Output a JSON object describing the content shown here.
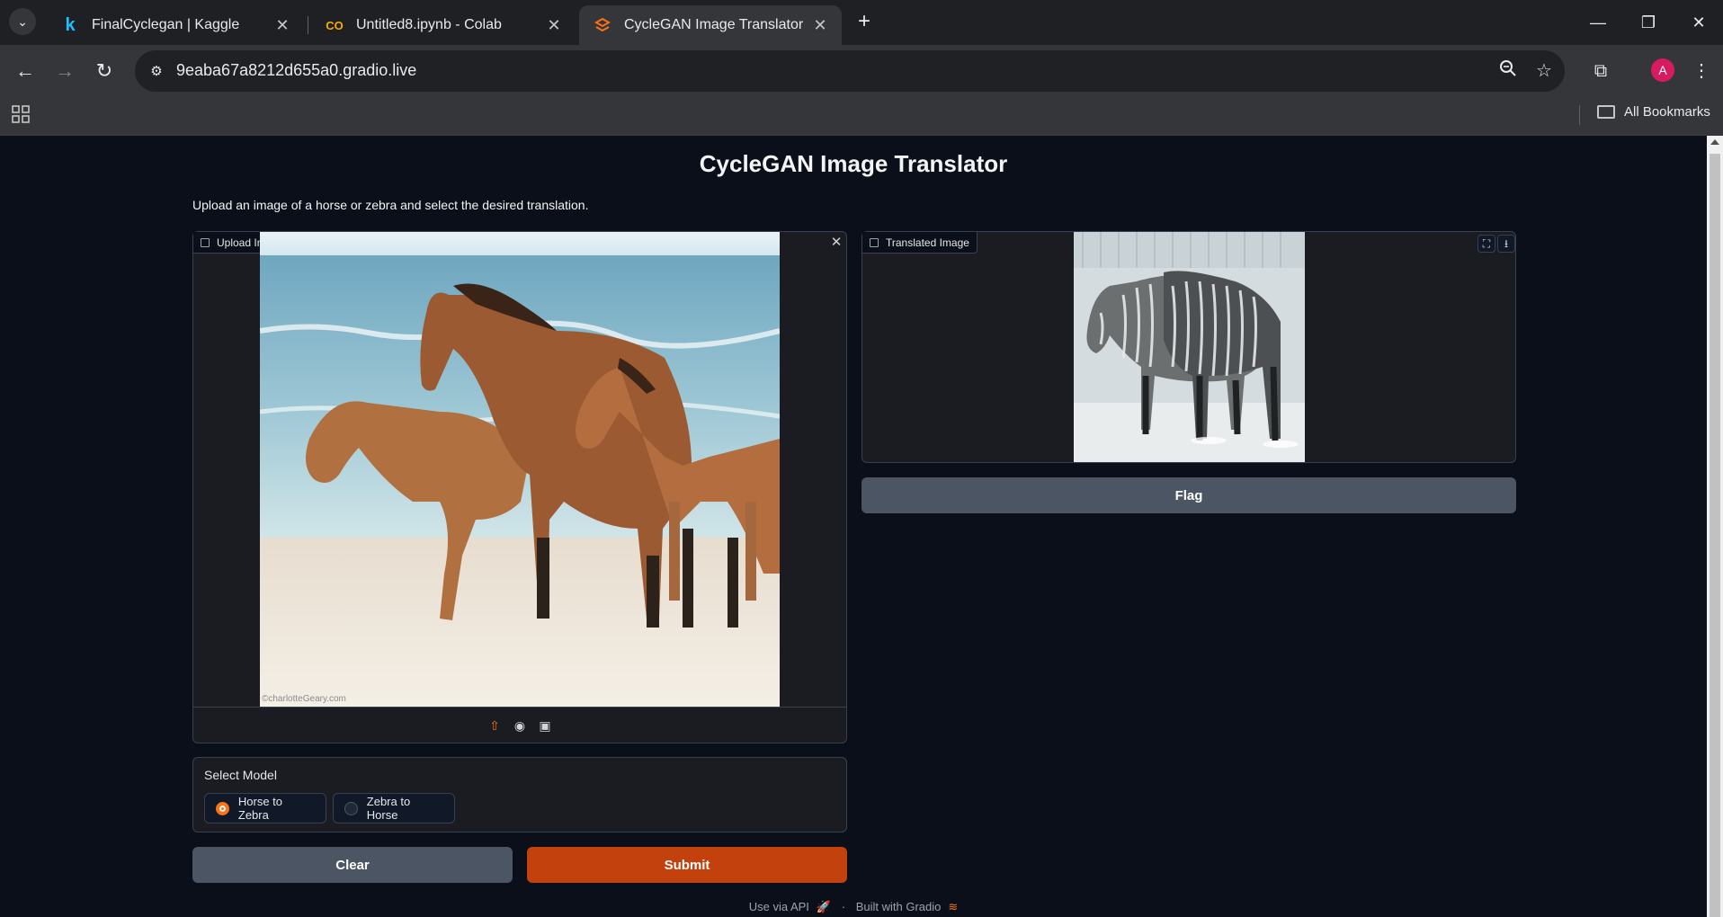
{
  "browser": {
    "tabs": [
      {
        "title": "FinalCyclegan | Kaggle",
        "favicon": "k",
        "active": false
      },
      {
        "title": "Untitled8.ipynb - Colab",
        "favicon": "CO",
        "active": false
      },
      {
        "title": "CycleGAN Image Translator",
        "favicon": "gradio-logo",
        "active": true
      }
    ],
    "url": "9eaba67a8212d655a0.gradio.live",
    "profile_initial": "A",
    "bookmarks_label": "All Bookmarks"
  },
  "app": {
    "title": "CycleGAN Image Translator",
    "description": "Upload an image of a horse or zebra and select the desired translation.",
    "input_label": "Upload Image",
    "output_label": "Translated Image",
    "watermark": "©charlotteGeary.com",
    "flag_label": "Flag",
    "select_label": "Select Model",
    "options": [
      {
        "label": "Horse to Zebra",
        "checked": true
      },
      {
        "label": "Zebra to Horse",
        "checked": false
      }
    ],
    "clear_label": "Clear",
    "submit_label": "Submit",
    "footer_api": "Use via API",
    "footer_sep": "·",
    "footer_built": "Built with Gradio"
  },
  "colors": {
    "accent": "#f97316",
    "primary_button": "#c2410c",
    "background": "#0b0f19"
  }
}
